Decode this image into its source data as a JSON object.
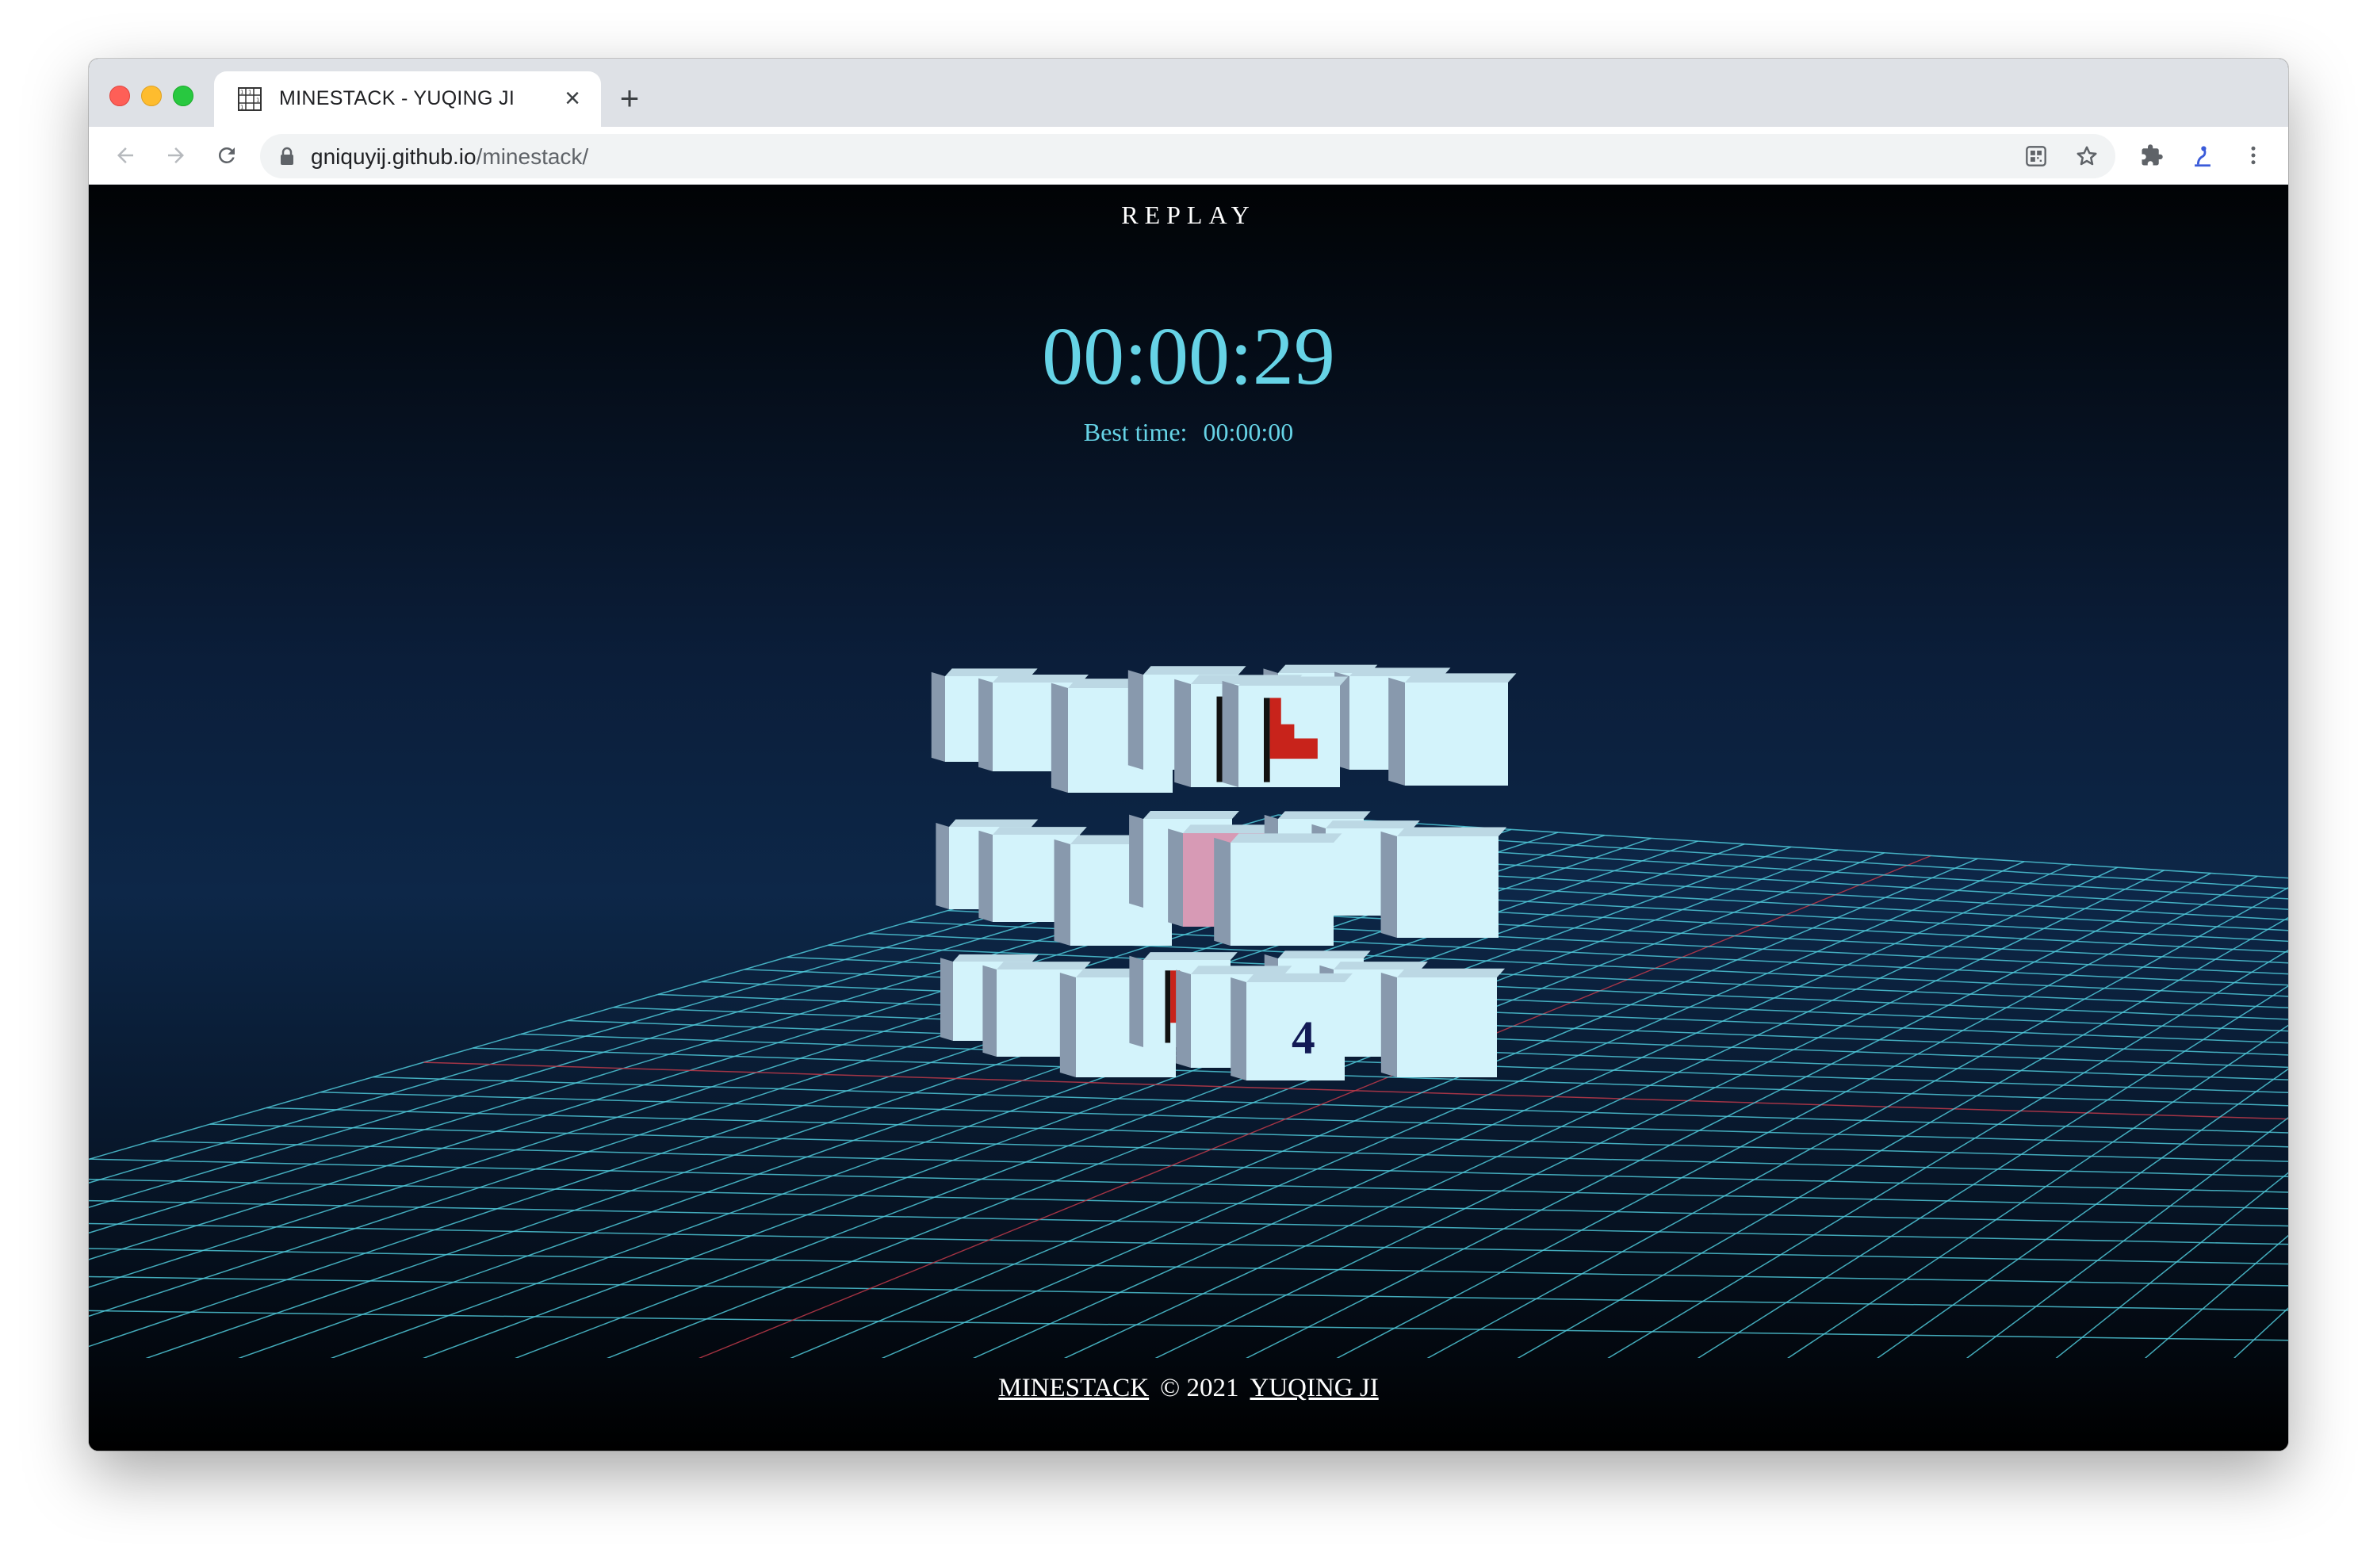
{
  "browser": {
    "tab_title": "MINESTACK - YUQING JI",
    "url_host": "gniquyij.github.io",
    "url_path": "/minestack/"
  },
  "game": {
    "replay_label": "REPLAY",
    "timer": "00:00:29",
    "best_label": "Best time:",
    "best_value": "00:00:00",
    "revealed_number": "4"
  },
  "footer": {
    "game_link": "MINESTACK",
    "copyright": "© 2021",
    "author_link": "YUQING JI"
  },
  "colors": {
    "accent": "#66d3e6",
    "grid": "#4fc8d8",
    "cube_face": "#d3f3fb",
    "flag": "#c8231b",
    "highlight_cube": "#d79ab5"
  }
}
